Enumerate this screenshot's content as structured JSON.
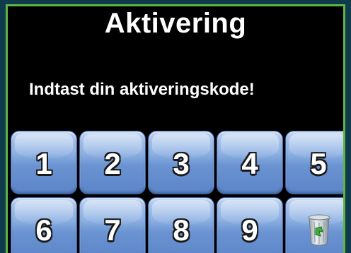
{
  "screen": {
    "title": "Aktivering",
    "prompt": "Indtast din aktiveringskode!"
  },
  "keypad": {
    "keys": [
      {
        "label": "1"
      },
      {
        "label": "2"
      },
      {
        "label": "3"
      },
      {
        "label": "4"
      },
      {
        "label": "5"
      },
      {
        "label": "6"
      },
      {
        "label": "7"
      },
      {
        "label": "8"
      },
      {
        "label": "9"
      }
    ],
    "delete_icon": "trash-icon"
  },
  "colors": {
    "background": "#0f3b4d",
    "frame_border": "#5fb544",
    "key_blue": "#6b93d2"
  }
}
